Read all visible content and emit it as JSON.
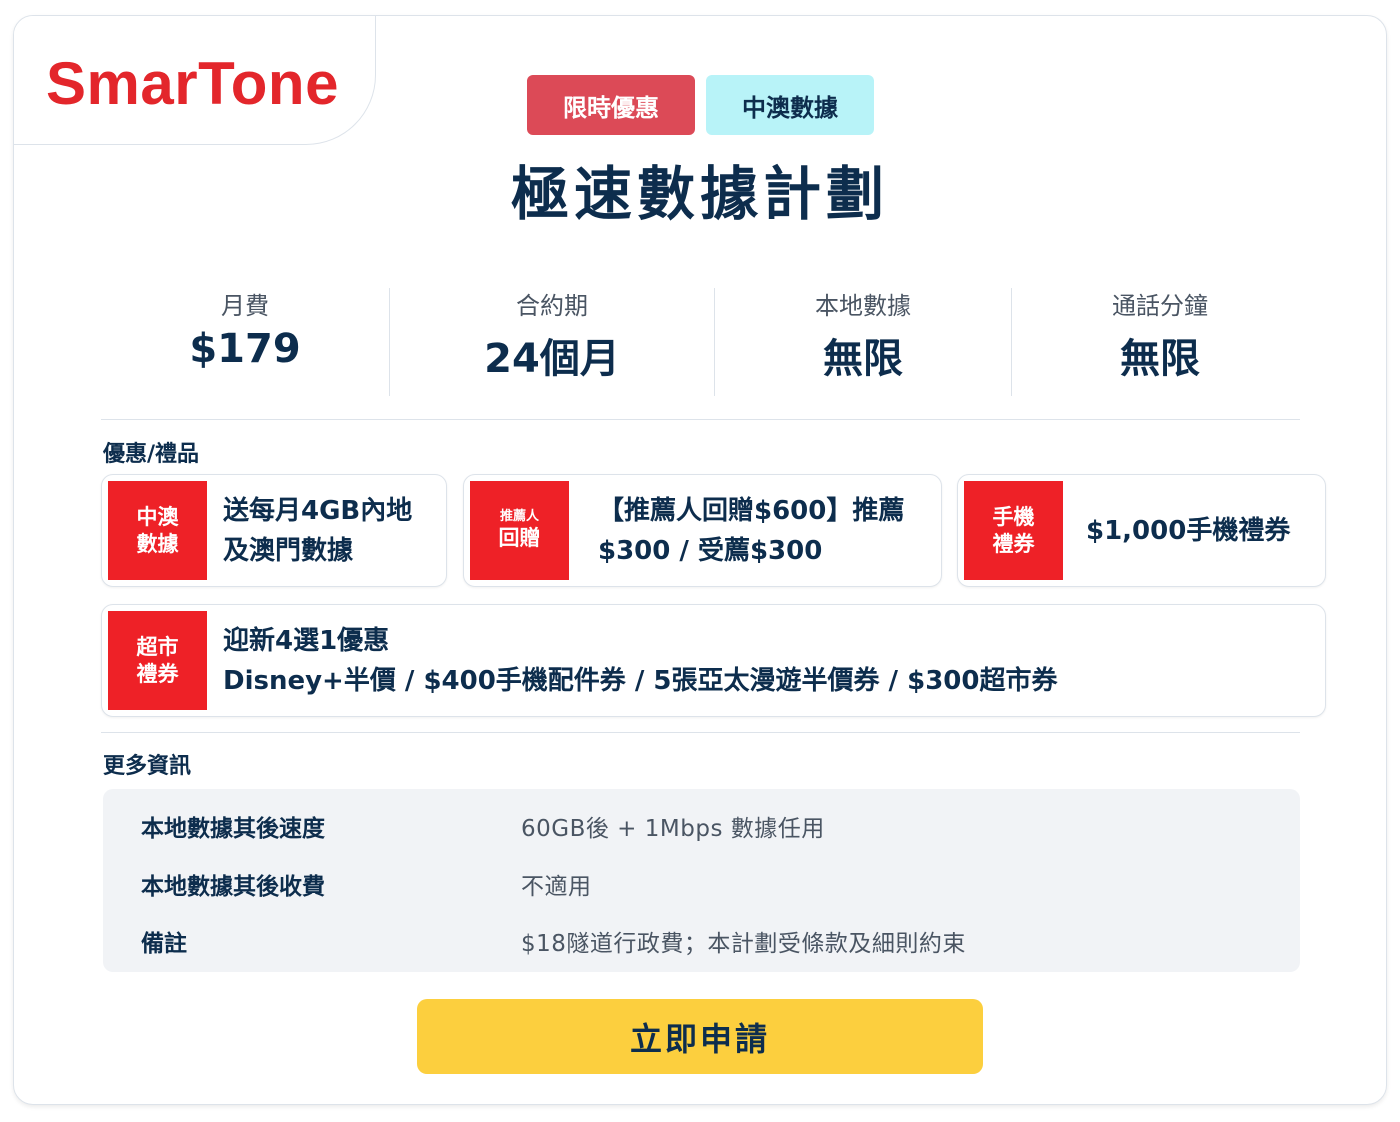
{
  "brand": {
    "logo_text": "SmarTone",
    "logo_color": "#e3262b"
  },
  "tags": {
    "promo": "限時優惠",
    "data_region": "中澳數據"
  },
  "plan": {
    "title": "極速數據計劃"
  },
  "summary": [
    {
      "label": "月費",
      "value": "$179"
    },
    {
      "label": "合約期",
      "value": "24個月"
    },
    {
      "label": "本地數據",
      "value": "無限"
    },
    {
      "label": "通話分鐘",
      "value": "無限"
    }
  ],
  "offers_section": {
    "label": "優惠/禮品",
    "items": [
      {
        "icon_line1": "中澳",
        "icon_line2": "數據",
        "text_line1": "送每月4GB內地",
        "text_line2": "及澳門數據"
      },
      {
        "icon_line1": "推薦人",
        "icon_line2": "回贈",
        "text_line1": "【推薦人回贈$600】推薦",
        "text_line2": "$300 / 受薦$300"
      },
      {
        "icon_line1": "手機",
        "icon_line2": "禮券",
        "text_line1": "$1,000手機禮券",
        "text_line2": ""
      },
      {
        "icon_line1": "超市",
        "icon_line2": "禮券",
        "text_line1": "迎新4選1優惠",
        "text_line2": "Disney+半價 / $400手機配件券 / 5張亞太漫遊半價券 / $300超市券"
      }
    ]
  },
  "more_info": {
    "label": "更多資訊",
    "rows": [
      {
        "key": "本地數據其後速度",
        "value": "60GB後 + 1Mbps 數據任用"
      },
      {
        "key": "本地數據其後收費",
        "value": "不適用"
      },
      {
        "key": "備註",
        "value": "$18隧道行政費；本計劃受條款及細則約束"
      }
    ]
  },
  "cta": {
    "label": "立即申請",
    "color": "#fccf3e"
  }
}
